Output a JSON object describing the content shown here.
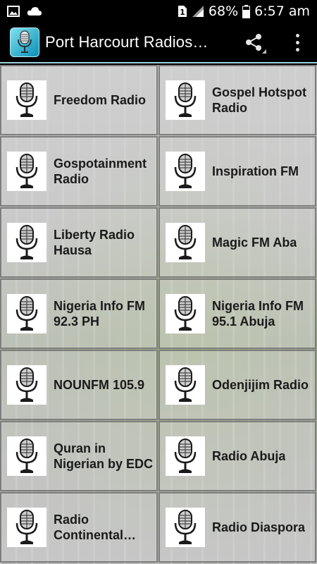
{
  "status_bar": {
    "battery": "68%",
    "time": "6:57 am",
    "sim_label": "1"
  },
  "app_bar": {
    "title": "Port Harcourt Radios…",
    "share_icon": "share-icon",
    "more_icon": "more-vert-icon"
  },
  "stations": [
    {
      "label": "Freedom Radio"
    },
    {
      "label": "Gospel Hotspot Radio"
    },
    {
      "label": "Gospotainment Radio"
    },
    {
      "label": "Inspiration FM"
    },
    {
      "label": "Liberty Radio Hausa"
    },
    {
      "label": "Magic FM Aba"
    },
    {
      "label": "Nigeria Info FM 92.3 PH"
    },
    {
      "label": "Nigeria Info FM 95.1 Abuja"
    },
    {
      "label": "NOUNFM 105.9"
    },
    {
      "label": "Odenjijim Radio"
    },
    {
      "label": "Quran in Nigerian by EDC"
    },
    {
      "label": "Radio Abuja"
    },
    {
      "label": "Radio Continental…"
    },
    {
      "label": "Radio Diaspora"
    }
  ],
  "colors": {
    "app_bar_bg": "#000000",
    "accent": "#9fd3e0",
    "tile_border": "#7d7d7d"
  }
}
